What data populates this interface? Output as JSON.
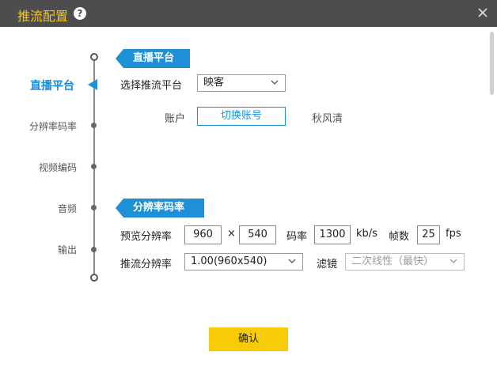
{
  "window": {
    "title": "推流配置",
    "help_glyph": "?"
  },
  "sidebar": {
    "active": "直播平台",
    "items": [
      "分辨率码率",
      "视频编码",
      "音频",
      "输出"
    ]
  },
  "section_platform": {
    "header": "直播平台",
    "select_label": "选择推流平台",
    "platform_value": "映客",
    "account_label": "账户",
    "switch_button": "切换账号",
    "account_name": "秋风清"
  },
  "section_resolution": {
    "header": "分辨率码率",
    "preview_label": "预览分辨率",
    "preview_width": "960",
    "times": "×",
    "preview_height": "540",
    "bitrate_label": "码率",
    "bitrate_value": "1300",
    "bitrate_unit": "kb/s",
    "fps_label": "帧数",
    "fps_value": "25",
    "fps_unit": "fps",
    "stream_label": "推流分辨率",
    "stream_value": "1.00(960x540)",
    "filter_label": "滤镜",
    "filter_value": "二次线性（最快）"
  },
  "footer": {
    "confirm": "确认"
  },
  "colors": {
    "accent": "#1e90d6",
    "title": "#f4c51c",
    "confirm": "#f7cb05",
    "titlebar": "#4d4d4d"
  }
}
